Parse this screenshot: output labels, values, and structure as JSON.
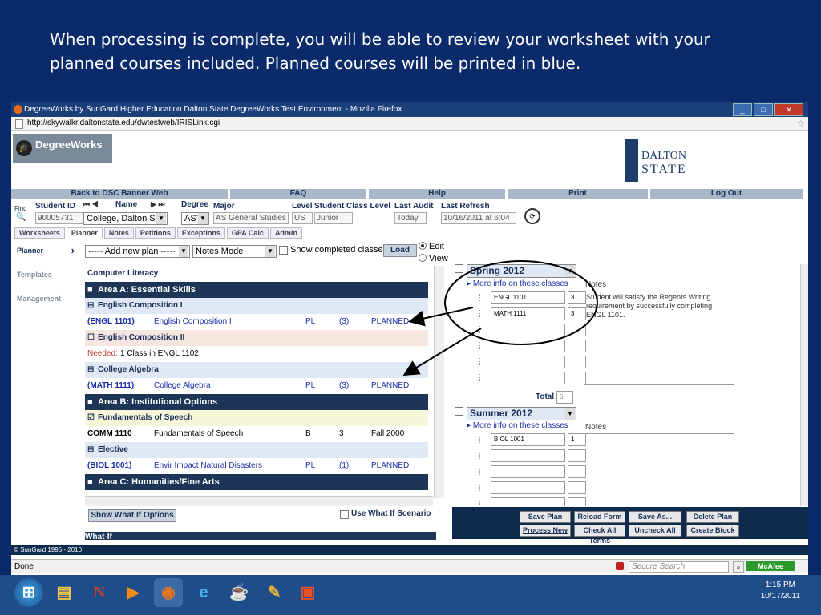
{
  "caption": {
    "line1": "When processing is complete,  you will be able to review your worksheet with your",
    "line2": "planned courses included.  Planned courses will be printed in blue."
  },
  "browser": {
    "title": "DegreeWorks by SunGard Higher Education Dalton State DegreeWorks Test Environment - Mozilla Firefox",
    "url": "http://skywalkr.daltonstate.edu/dwtestweb/IRISLink.cgi",
    "status": "Done",
    "secure_search_placeholder": "Secure Search",
    "mcafee": "McAfee"
  },
  "logo": {
    "app": "DegreeWorks",
    "school1": "DALTON",
    "school2": "STATE"
  },
  "navbar": [
    "Back to DSC Banner Web",
    "FAQ",
    "Help",
    "Print",
    "Log Out"
  ],
  "student": {
    "find_label": "Find",
    "id_label": "Student ID",
    "id": "90005731",
    "name_label": "Name",
    "name": "College, Dalton S.",
    "degree_label": "Degree",
    "degree": "ASTI",
    "major_label": "Major",
    "major": "AS General Studies",
    "level_label": "Level",
    "level": "US",
    "class_label": "Student Class Level",
    "class": "Junior",
    "audit_label": "Last Audit",
    "audit": "Today",
    "refresh_label": "Last Refresh",
    "refresh": "10/16/2011 at 6:04"
  },
  "tabs": [
    "Worksheets",
    "Planner",
    "Notes",
    "Petitions",
    "Exceptions",
    "GPA Calc",
    "Admin"
  ],
  "leftnav": [
    "Planner",
    "Templates",
    "Management"
  ],
  "toolbar": {
    "add_plan": "----- Add new plan -----",
    "mode": "Notes Mode",
    "show_completed": "Show completed classes",
    "load": "Load",
    "edit": "Edit",
    "view": "View"
  },
  "audit_rows": [
    {
      "type": "plain",
      "c1": "Computer Literacy"
    },
    {
      "type": "area",
      "c1": "Area A: Essential Skills"
    },
    {
      "type": "rule",
      "c1": "English Composition I"
    },
    {
      "type": "course",
      "c1": "(ENGL 1101)",
      "c2": "English Composition I",
      "c3": "PL",
      "c4": "(3)",
      "c5": "PLANNED",
      "blue": true
    },
    {
      "type": "rule2",
      "c1": "English Composition II"
    },
    {
      "type": "needed",
      "c1": "Needed:",
      "c2": "1 Class in ENGL 1102"
    },
    {
      "type": "rule",
      "c1": "College Algebra"
    },
    {
      "type": "course",
      "c1": "(MATH 1111)",
      "c2": "College Algebra",
      "c3": "PL",
      "c4": "(3)",
      "c5": "PLANNED",
      "blue": true
    },
    {
      "type": "area",
      "c1": "Area B: Institutional Options"
    },
    {
      "type": "rule3",
      "c1": "Fundamentals of Speech"
    },
    {
      "type": "course",
      "c1": "COMM 1110",
      "c2": "Fundamentals of Speech",
      "c3": "B",
      "c4": "3",
      "c5": "Fall 2000",
      "blue": false
    },
    {
      "type": "rule",
      "c1": "Elective"
    },
    {
      "type": "course",
      "c1": "(BIOL 1001)",
      "c2": "Envir Impact Natural Disasters",
      "c3": "PL",
      "c4": "(1)",
      "c5": "PLANNED",
      "blue": true
    },
    {
      "type": "area",
      "c1": "Area C: Humanities/Fine Arts"
    }
  ],
  "whatif": {
    "show": "Show What If Options",
    "use": "Use What If Scenario",
    "next": "What-If"
  },
  "planner": {
    "term1": "Spring 2012",
    "more1": "More info on these classes",
    "notes_label": "Notes",
    "note1": "Student will satisfy the Regents Writing requirement by successfully completing ENGL 1101.",
    "courses1": [
      {
        "course": "ENGL 1101",
        "cr": "3"
      },
      {
        "course": "MATH 1111",
        "cr": "3"
      }
    ],
    "total_label": "Total",
    "total": "6",
    "term2": "Summer 2012",
    "more2": "More info on these classes",
    "courses2": [
      {
        "course": "BIOL 1001",
        "cr": "1"
      }
    ]
  },
  "buttons": [
    "Save Plan",
    "Reload Form",
    "Save As...",
    "Delete Plan",
    "Process New",
    "Check All Terms",
    "Uncheck All",
    "Create Block"
  ],
  "footer": "© SunGard 1995 - 2010",
  "clock": {
    "time": "1:15 PM",
    "date": "10/17/2011"
  },
  "colors": {
    "planned_blue": "#1a2ea8",
    "area_header": "#1d3557",
    "slide_bg": "#0b2a6a"
  }
}
